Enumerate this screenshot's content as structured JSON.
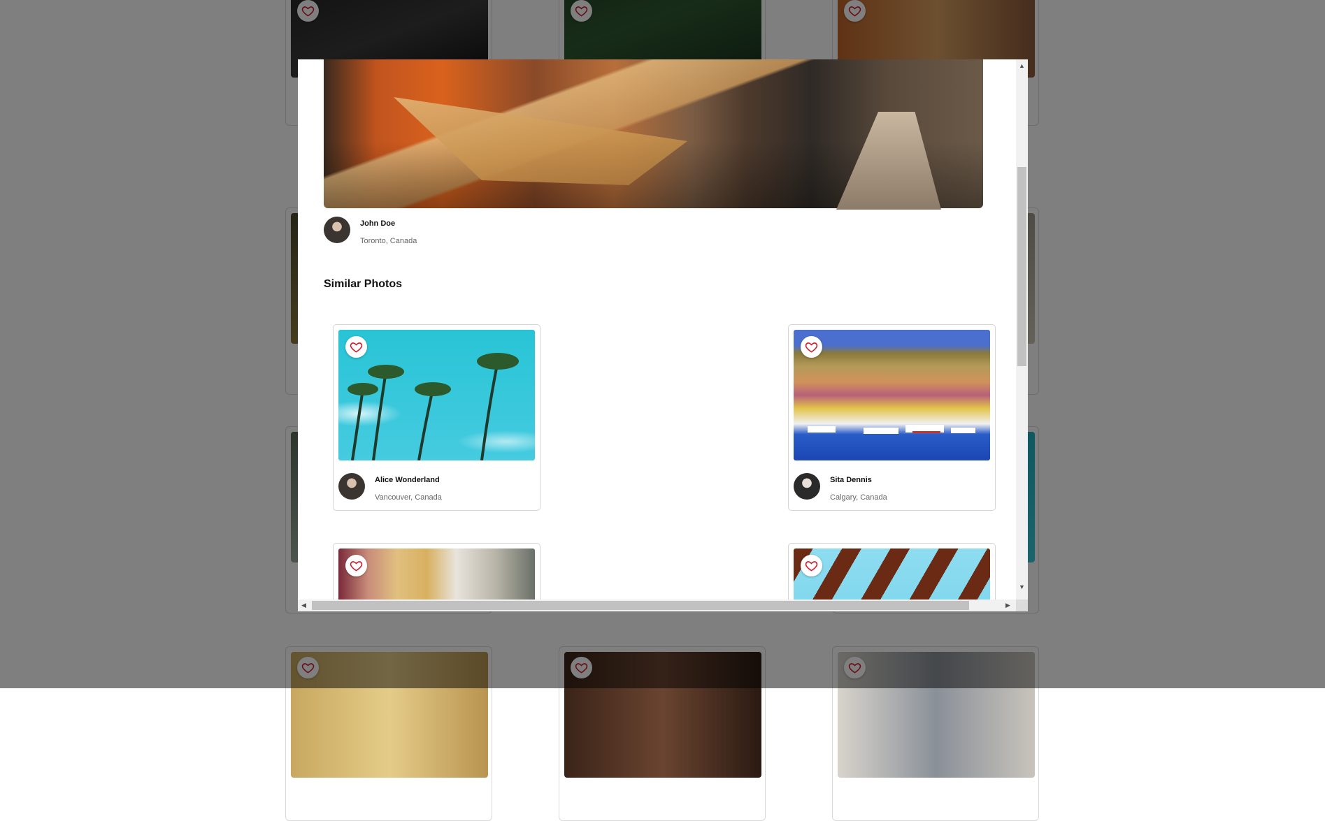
{
  "main_photo": {
    "author": {
      "name": "John Doe",
      "location": "Toronto, Canada"
    }
  },
  "similar": {
    "title": "Similar Photos",
    "photos": [
      {
        "name": "Alice Wonderland",
        "location": "Vancouver, Canada"
      },
      {
        "name": "Sita Dennis",
        "location": "Calgary, Canada"
      },
      {
        "name": "",
        "location": ""
      },
      {
        "name": "",
        "location": ""
      }
    ]
  },
  "colors": {
    "favorite_icon": "#d11a2a",
    "overlay": "rgba(0,0,0,0.5)"
  },
  "icons": [
    "heart-icon",
    "scroll-up-arrow-icon",
    "scroll-down-arrow-icon",
    "scroll-left-arrow-icon",
    "scroll-right-arrow-icon"
  ]
}
